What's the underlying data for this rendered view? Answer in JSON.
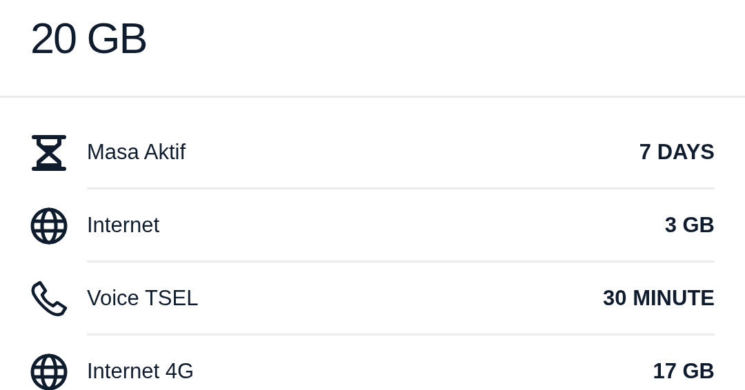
{
  "package": {
    "quota": "20 GB"
  },
  "benefits": [
    {
      "kind": "hourglass",
      "name": "Masa Aktif",
      "value": "7 DAYS"
    },
    {
      "kind": "globe",
      "name": "Internet",
      "value": "3 GB"
    },
    {
      "kind": "phone",
      "name": "Voice TSEL",
      "value": "30 MINUTE"
    },
    {
      "kind": "globe",
      "name": "Internet 4G",
      "value": "17 GB"
    }
  ]
}
